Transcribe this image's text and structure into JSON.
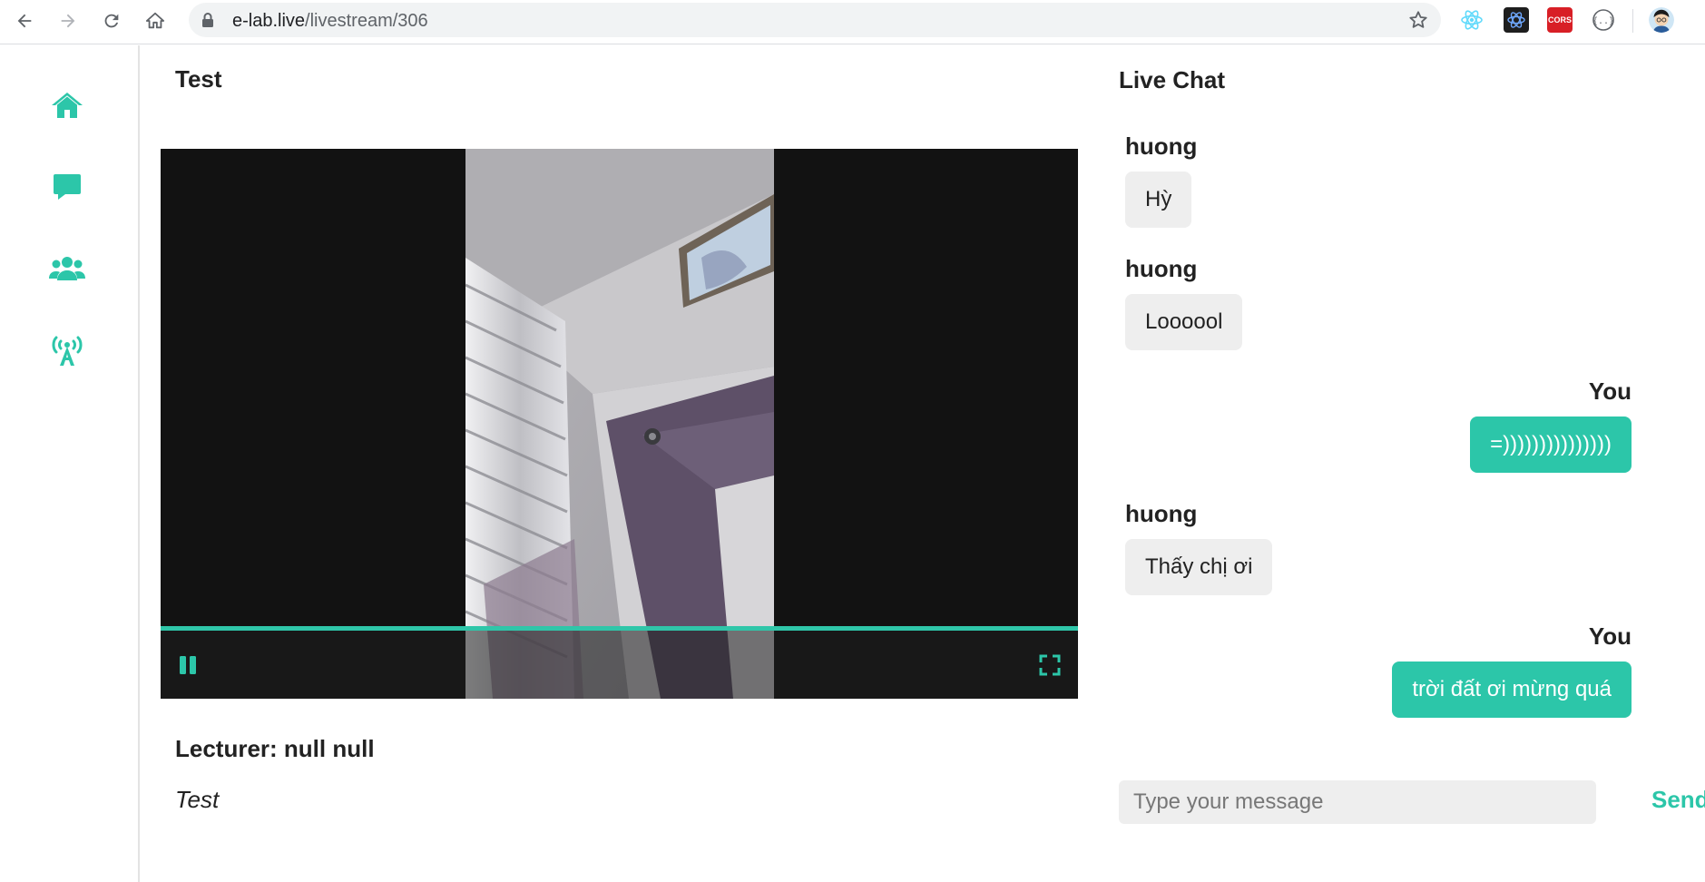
{
  "browser": {
    "url_host": "e-lab.live",
    "url_path": "/livestream/306",
    "extensions": [
      "react-devtools-icon",
      "redux-icon",
      "cors-icon",
      "json-viewer-icon"
    ],
    "cors_label": "CORS"
  },
  "sidebar": {
    "items": [
      {
        "name": "home",
        "icon": "home-icon"
      },
      {
        "name": "chat",
        "icon": "chat-icon"
      },
      {
        "name": "users",
        "icon": "users-icon"
      },
      {
        "name": "livestream",
        "icon": "broadcast-icon"
      }
    ]
  },
  "stream": {
    "title": "Test",
    "lecturer": "Lecturer: null null",
    "description": "Test",
    "playing": true,
    "progress": 1.0
  },
  "chat": {
    "title": "Live Chat",
    "messages": [
      {
        "sender": "huong",
        "text": "Hỳ",
        "mine": false
      },
      {
        "sender": "huong",
        "text": "Loooool",
        "mine": false
      },
      {
        "sender": "You",
        "text": "=)))))))))))))))",
        "mine": true
      },
      {
        "sender": "huong",
        "text": "Thấy chị ơi",
        "mine": false
      },
      {
        "sender": "You",
        "text": "trời đất ơi mừng quá",
        "mine": true
      }
    ],
    "input_placeholder": "Type your message",
    "input_value": "",
    "send_label": "Send"
  },
  "colors": {
    "accent": "#2cc6a9",
    "bubble_other": "#eeeeee",
    "video_bg": "#121212"
  }
}
